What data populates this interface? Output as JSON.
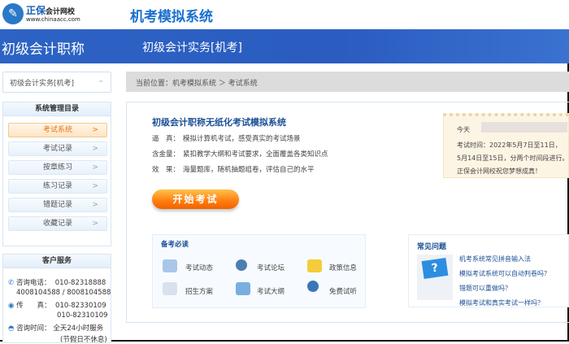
{
  "header": {
    "logo_text": "正保",
    "brand": "会计网校",
    "url": "www.chinaacc.com",
    "system_title": "机考模拟系统"
  },
  "banner": {
    "left": "初级会计职称",
    "right": "初级会计实务[机考]"
  },
  "subject_select": {
    "value": "初级会计实务[机考]"
  },
  "breadcrumb": {
    "text": "当前位置：机考模拟系统 ＞ 考试系统"
  },
  "menu": {
    "title": "系统管理目录",
    "items": [
      "考试系统",
      "考试记录",
      "按章练习",
      "练习记录",
      "错题记录",
      "收藏记录"
    ],
    "arrow": ">"
  },
  "service": {
    "title": "客户服务",
    "phone_label": "咨询电话：",
    "phone1": "010-82318888",
    "phone2": "4008104588 / 8008104588",
    "fax_label": "传　　真：",
    "fax1": "010-82330109",
    "fax2": "010-82310109",
    "hours_label": "咨询时间：",
    "hours": "全天24小时服务",
    "hours_note": "(节假日不休息)"
  },
  "main": {
    "title": "初级会计职称无纸化考试模拟系统",
    "features": [
      {
        "k": "逼　真：",
        "v": "模拟计算机考试，感受真实的考试场景"
      },
      {
        "k": "含金量：",
        "v": "紧扣教学大纲和考试要求，全面覆盖各类知识点"
      },
      {
        "k": "效　果：",
        "v": "海量题库，随机抽题组卷，评估自己的水平"
      }
    ],
    "start_button": "开始考试"
  },
  "notice": {
    "today": "今天",
    "line1": "考试时间：2022年5月7日至11日，",
    "line2": "5月14日至15日，分两个时间段进行。",
    "line3": "正保会计网校祝您梦想成真！"
  },
  "prep": {
    "title": "备考必读",
    "items": [
      "考试动态",
      "考试论坛",
      "政策信息",
      "招生方案",
      "考试大纲",
      "免费试听"
    ]
  },
  "faq": {
    "title": "常见问题",
    "items": [
      "机考系统常见拼音输入法",
      "模拟考试系统可以自动判卷吗？",
      "错题可以重做吗？",
      "模拟考试和真实考试一样吗？"
    ]
  },
  "colors": {
    "banner": "#2c63c4",
    "accent": "#ff7d10",
    "link": "#1b4f95"
  }
}
